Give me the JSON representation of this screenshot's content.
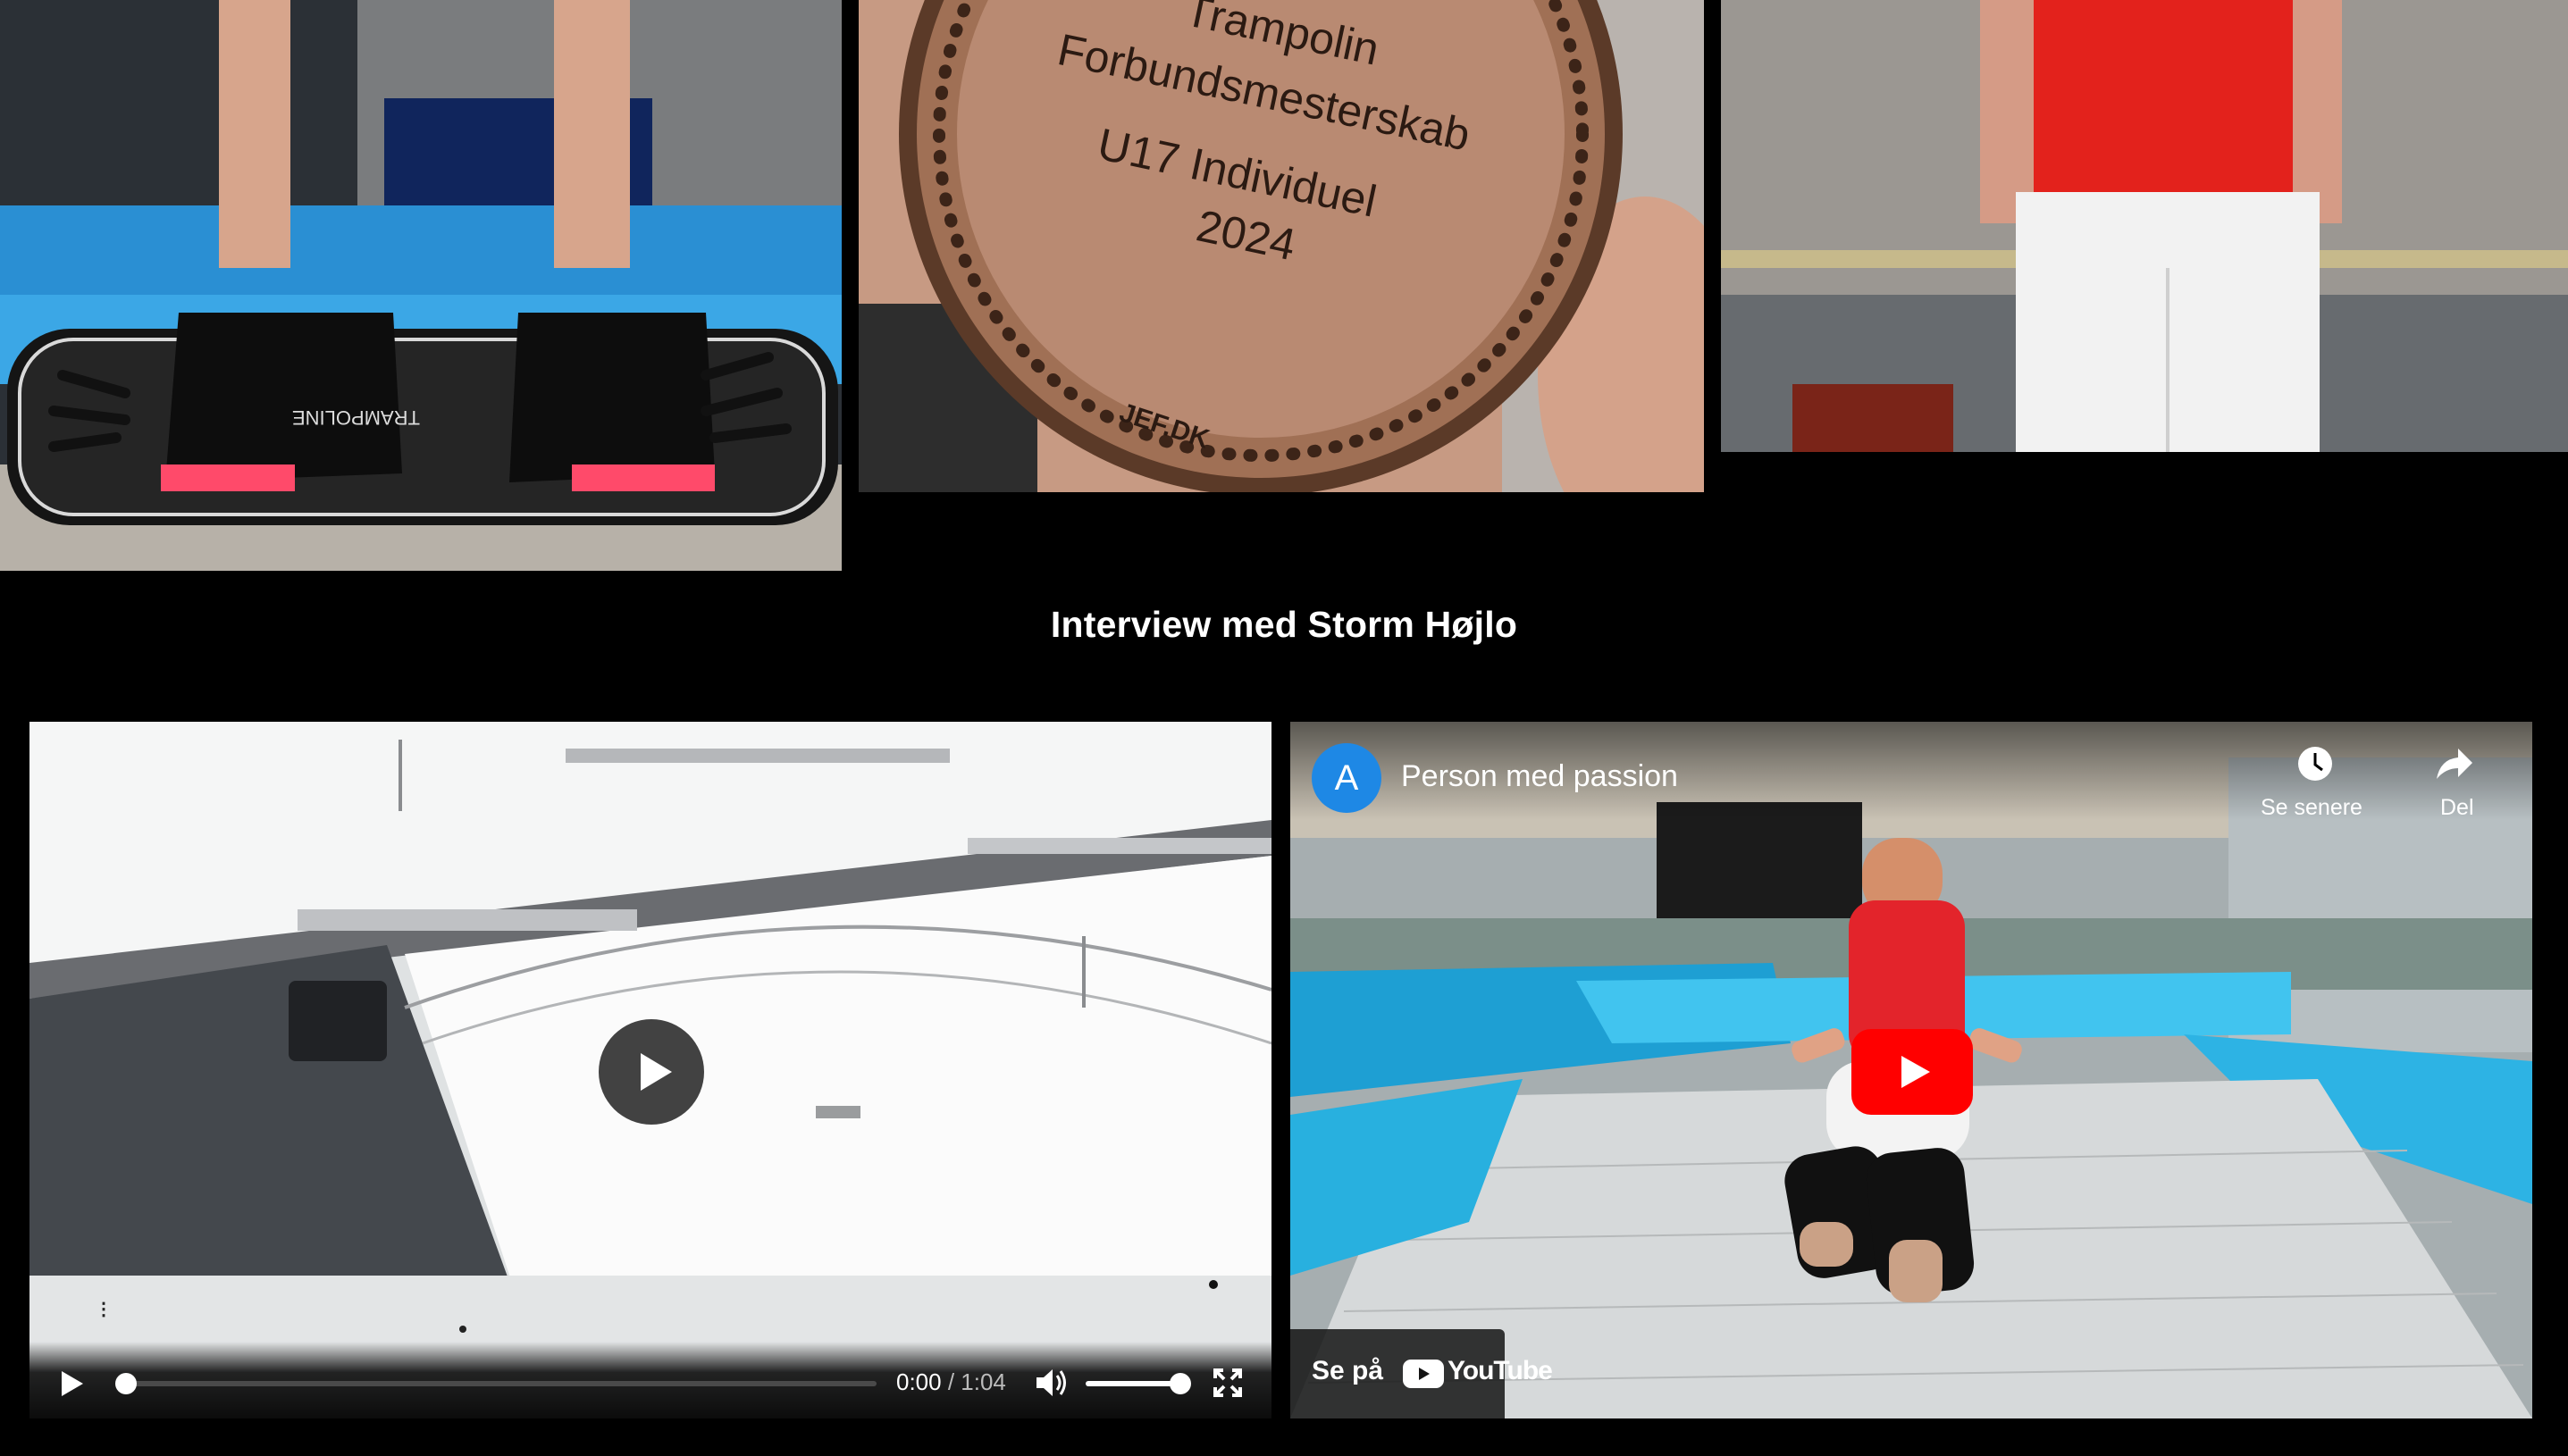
{
  "section": {
    "title": "Interview med Storm Højlo"
  },
  "photos": [
    {
      "caption_brand": "TRAMPOLINE"
    },
    {
      "medal_lines": [
        "Trampolin",
        "Forbundsmesterskab",
        "U17 Individuel",
        "2024"
      ],
      "medal_mark": "JEF.DK"
    },
    {}
  ],
  "player1": {
    "time_current": "0:00",
    "time_sep": " / ",
    "time_total": "1:04",
    "progress": 0.0,
    "volume": 1.0
  },
  "player2": {
    "channel_initial": "A",
    "title": "Person med passion",
    "watch_later": "Se senere",
    "share": "Del",
    "watch_on": "Se på",
    "youtube_brand": "YouTube"
  },
  "colors": {
    "background": "#000000",
    "youtube_red": "#ff0000",
    "avatar_blue": "#1e88e5"
  }
}
